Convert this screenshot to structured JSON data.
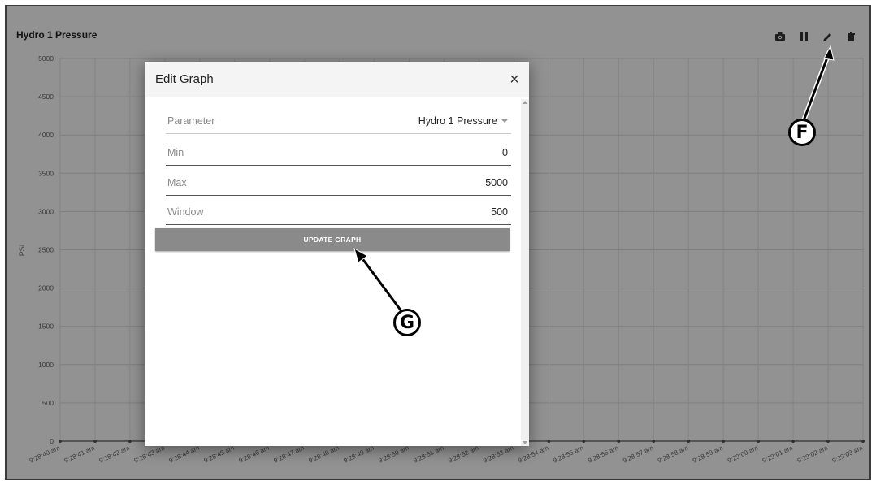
{
  "chart": {
    "title": "Hydro 1 Pressure",
    "ylabel": "PSI",
    "toolbar": [
      "camera-icon",
      "pause-icon",
      "pencil-icon",
      "trash-icon"
    ]
  },
  "chart_data": {
    "type": "line",
    "title": "Hydro 1 Pressure",
    "ylabel": "PSI",
    "ylim": [
      0,
      5000
    ],
    "yticks": [
      "5000",
      "4500",
      "4000",
      "3500",
      "3000",
      "2500",
      "2000",
      "1500",
      "1000",
      "500",
      "0"
    ],
    "x": [
      "9:28:40 am",
      "9:28:41 am",
      "9:28:42 am",
      "9:28:43 am",
      "9:28:44 am",
      "9:28:45 am",
      "9:28:46 am",
      "9:28:47 am",
      "9:28:48 am",
      "9:28:49 am",
      "9:28:50 am",
      "9:28:51 am",
      "9:28:52 am",
      "9:28:53 am",
      "9:28:54 am",
      "9:28:55 am",
      "9:28:56 am",
      "9:28:57 am",
      "9:28:58 am",
      "9:28:59 am",
      "9:29:00 am",
      "9:29:01 am",
      "9:29:02 am",
      "9:29:03 am"
    ],
    "series": [
      {
        "values": [
          0,
          0,
          0,
          0,
          0,
          0,
          0,
          0,
          0,
          0,
          0,
          0,
          0,
          0,
          0,
          0,
          0,
          0,
          0,
          0,
          0,
          0,
          0,
          0
        ]
      }
    ],
    "grid": true
  },
  "modal": {
    "title": "Edit Graph",
    "close_glyph": "×",
    "fields": {
      "parameter": {
        "label": "Parameter",
        "value": "Hydro 1 Pressure"
      },
      "min": {
        "label": "Min",
        "value": "0"
      },
      "max": {
        "label": "Max",
        "value": "5000"
      },
      "window": {
        "label": "Window",
        "value": "500"
      }
    },
    "update_button": "UPDATE GRAPH"
  },
  "callouts": {
    "f": "F",
    "g": "G"
  }
}
